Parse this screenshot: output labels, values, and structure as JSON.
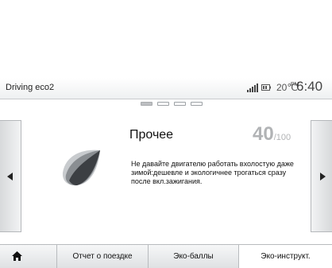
{
  "status_bar": {
    "app_title": "Driving eco2",
    "temperature": "20℃",
    "ampm": "PM",
    "time": "6:40",
    "icons": [
      "signal-icon",
      "battery-icon"
    ]
  },
  "pager": {
    "pages": 4,
    "current": 1
  },
  "content": {
    "title": "Прочее",
    "score": "40",
    "score_max": "/100",
    "message": "Не давайте двигателю работать вхолостую даже зимой:дешевле и экологичнее трогаться сразу после вкл.зажигания.",
    "icon": "eco-leaf-icon"
  },
  "navigation": {
    "left_icon": "arrow-left-icon",
    "right_icon": "arrow-right-icon"
  },
  "tabs": {
    "home_icon": "home-icon",
    "items": [
      {
        "label": "Отчет о поездке"
      },
      {
        "label": "Эко-баллы"
      },
      {
        "label": "Эко-инструкт."
      }
    ],
    "active_index": 2
  },
  "colors": {
    "score_gray": "#b1b3b5",
    "leaf_dark": "#3c3f43",
    "leaf_mid": "#8a8e92",
    "leaf_light": "#c8cbce"
  }
}
